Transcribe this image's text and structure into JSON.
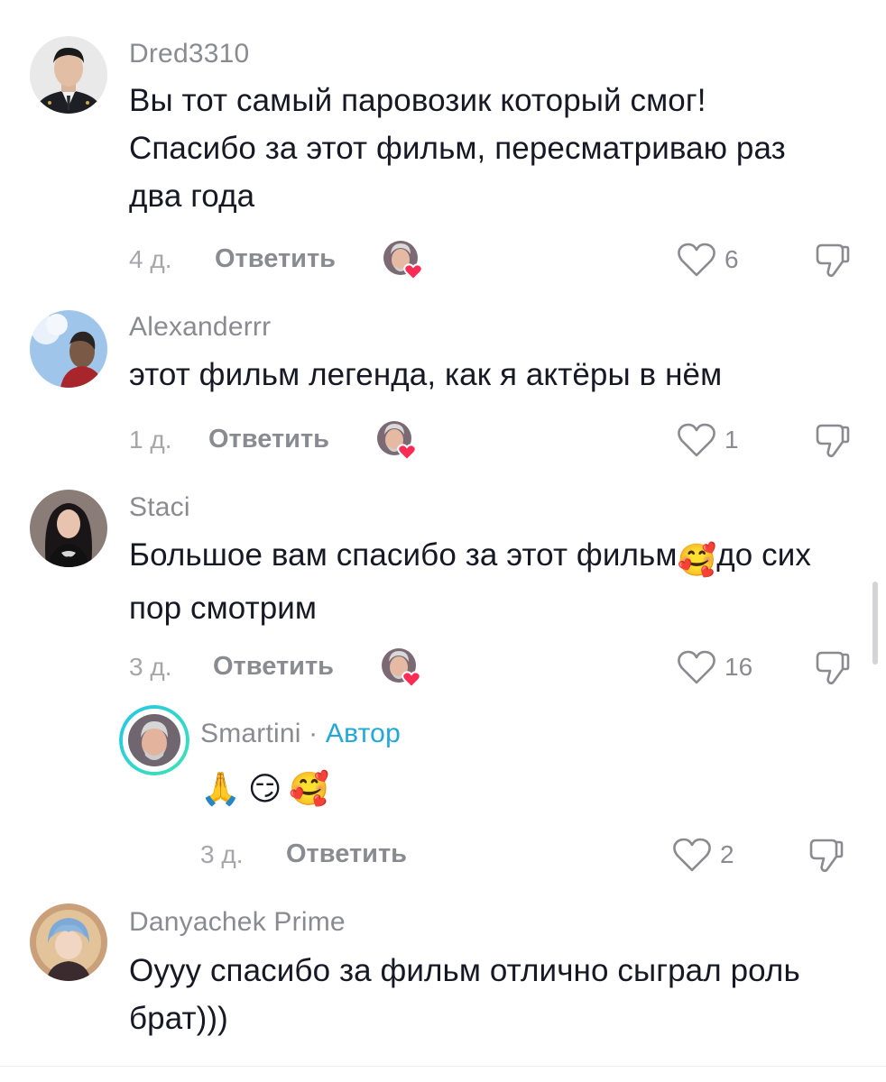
{
  "comments": [
    {
      "username": "Dred3310",
      "text": "Вы тот самый паровозик который смог! Спасибо за этот фильм, пересматриваю раз два года",
      "date": "4 д.",
      "reply_label": "Ответить",
      "likes": "6"
    },
    {
      "username": "Alexanderrr",
      "text": "этот фильм легенда, как я актёры в нём",
      "date": "1 д.",
      "reply_label": "Ответить",
      "likes": "1"
    },
    {
      "username": "Staci",
      "text_before_emoji": "Большое вам спасибо за этот фильм",
      "emoji": "🥰",
      "text_after_emoji": "до сих пор смотрим",
      "date": "3 д.",
      "reply_label": "Ответить",
      "likes": "16"
    },
    {
      "username": "Smartini",
      "separator": " · ",
      "author_label": "Автор",
      "emojis": [
        "🙏",
        "😏",
        "🥰"
      ],
      "date": "3 д.",
      "reply_label": "Ответить",
      "likes": "2"
    },
    {
      "username": "Danyachek Prime",
      "text": "Оууу спасибо за фильм отлично сыграл роль брат)))"
    }
  ],
  "colors": {
    "text": "#161823",
    "muted": "#8a8b91",
    "author_accent": "#20a8d8",
    "heart_red": "#fe2c55"
  },
  "icons": {
    "like": "heart-outline-icon",
    "dislike": "thumbs-down-icon",
    "creator_liked": "creator-liked-heart-badge"
  }
}
